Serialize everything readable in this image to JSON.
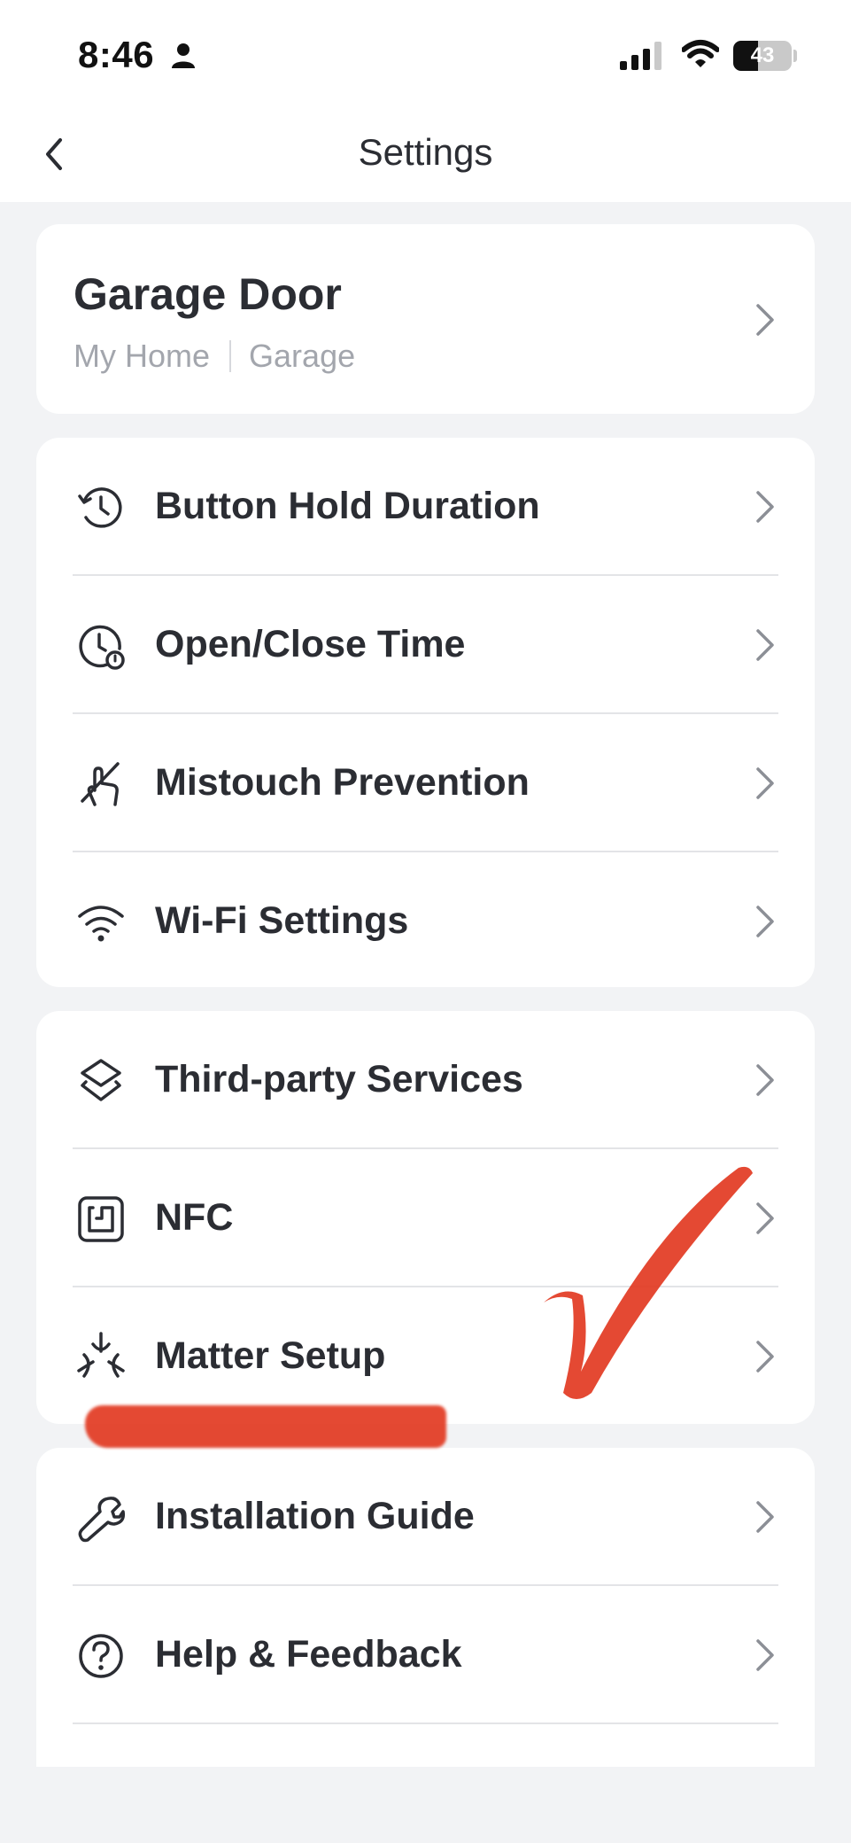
{
  "status_bar": {
    "time": "8:46",
    "battery": "43",
    "icons": [
      "person-icon",
      "cellular-signal-icon",
      "wifi-icon",
      "battery-icon"
    ]
  },
  "nav": {
    "title": "Settings",
    "back_icon": "chevron-left-icon"
  },
  "device": {
    "name": "Garage Door",
    "home": "My Home",
    "room": "Garage"
  },
  "groups": [
    {
      "items": [
        {
          "label": "Button Hold Duration",
          "icon": "clock-history-icon"
        },
        {
          "label": "Open/Close Time",
          "icon": "clock-timer-icon"
        },
        {
          "label": "Mistouch Prevention",
          "icon": "hand-no-touch-icon"
        },
        {
          "label": "Wi-Fi Settings",
          "icon": "wifi-icon"
        }
      ]
    },
    {
      "items": [
        {
          "label": "Third-party Services",
          "icon": "layers-icon"
        },
        {
          "label": "NFC",
          "icon": "nfc-icon"
        },
        {
          "label": "Matter Setup",
          "icon": "matter-icon"
        }
      ]
    },
    {
      "items": [
        {
          "label": "Installation Guide",
          "icon": "wrench-icon"
        },
        {
          "label": "Help & Feedback",
          "icon": "help-circle-icon"
        }
      ]
    }
  ],
  "colors": {
    "background": "#f2f3f5",
    "card": "#ffffff",
    "text": "#2b2d33",
    "secondary_text": "#a3a6ad",
    "annotation": "#e23a22"
  }
}
